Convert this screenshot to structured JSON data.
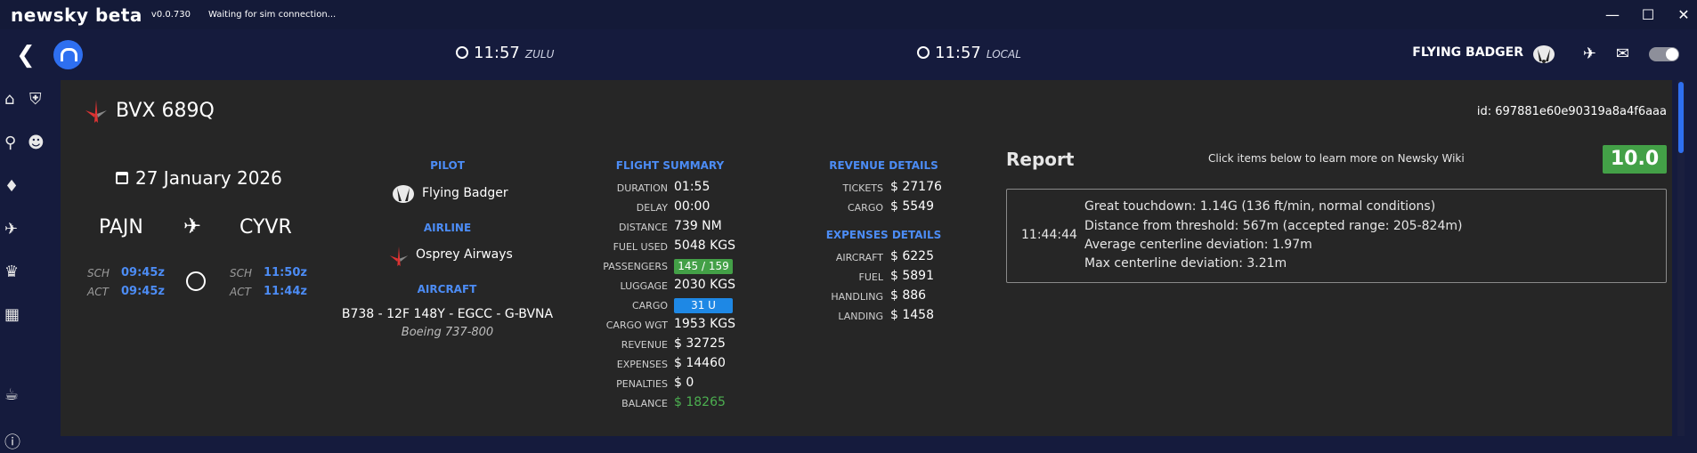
{
  "titlebar": {
    "brand": "newsky beta",
    "version": "v0.0.730",
    "status": "Waiting for sim connection..."
  },
  "header": {
    "zulu_time": "11:57",
    "zulu_label": "ZULU",
    "local_time": "11:57",
    "local_label": "LOCAL",
    "pilot_name": "FLYING BADGER"
  },
  "flight": {
    "callsign": "BVX 689Q",
    "id_text": "id: 697881e60e90319a8a4f6aaa",
    "date": "27 January 2026",
    "dep": "PAJN",
    "arr": "CYVR",
    "sch_label": "SCH",
    "act_label": "ACT",
    "dep_sch": "09:45z",
    "dep_act": "09:45z",
    "arr_sch": "11:50z",
    "arr_act": "11:44z"
  },
  "pilot_section": {
    "pilot_head": "PILOT",
    "pilot": "Flying Badger",
    "airline_head": "AIRLINE",
    "airline": "Osprey Airways",
    "aircraft_head": "AIRCRAFT",
    "aircraft": "B738 - 12F 148Y - EGCC - G-BVNA",
    "aircraft_type": "Boeing 737-800"
  },
  "summary": {
    "head": "FLIGHT SUMMARY",
    "rows": [
      {
        "label": "DURATION",
        "value": "01:55"
      },
      {
        "label": "DELAY",
        "value": "00:00"
      },
      {
        "label": "DISTANCE",
        "value": "739 NM"
      },
      {
        "label": "FUEL USED",
        "value": "5048 KGS"
      },
      {
        "label": "PASSENGERS",
        "value": "145 / 159"
      },
      {
        "label": "LUGGAGE",
        "value": "2030 KGS"
      },
      {
        "label": "CARGO",
        "value": "31 U"
      },
      {
        "label": "CARGO WGT",
        "value": "1953 KGS"
      },
      {
        "label": "REVENUE",
        "value": "$ 32725"
      },
      {
        "label": "EXPENSES",
        "value": "$ 14460"
      },
      {
        "label": "PENALTIES",
        "value": "$ 0"
      },
      {
        "label": "BALANCE",
        "value": "$ 18265"
      }
    ],
    "passengers_fill": 0.91,
    "colors": {
      "green": "#43a047",
      "blue": "#1e88e5"
    }
  },
  "revenue": {
    "head": "REVENUE DETAILS",
    "rows": [
      {
        "label": "TICKETS",
        "value": "$ 27176"
      },
      {
        "label": "CARGO",
        "value": "$ 5549"
      }
    ]
  },
  "expenses": {
    "head": "EXPENSES DETAILS",
    "rows": [
      {
        "label": "AIRCRAFT",
        "value": "$ 6225"
      },
      {
        "label": "FUEL",
        "value": "$ 5891"
      },
      {
        "label": "HANDLING",
        "value": "$ 886"
      },
      {
        "label": "LANDING",
        "value": "$ 1458"
      }
    ]
  },
  "report": {
    "title": "Report",
    "hint": "Click items below to learn more on Newsky Wiki",
    "score": "10.0",
    "time": "11:44:44",
    "lines": [
      "Great touchdown: 1.14G (136 ft/min, normal conditions)",
      "Distance from threshold: 567m (accepted range: 205-824m)",
      "Average centerline deviation: 1.97m",
      "Max centerline deviation: 3.21m"
    ]
  },
  "icons": [
    "back-icon",
    "newsky-logo-icon",
    "clock-icon",
    "badger-avatar-icon",
    "flights-icon",
    "mail-icon",
    "theme-toggle-icon",
    "home-icon",
    "shield-icon",
    "search-icon",
    "discord-icon",
    "tag-icon",
    "landing-icon",
    "trophy-icon",
    "map-icon",
    "coffee-icon",
    "help-icon",
    "calendar-icon",
    "airplane-icon",
    "gauge-icon"
  ]
}
